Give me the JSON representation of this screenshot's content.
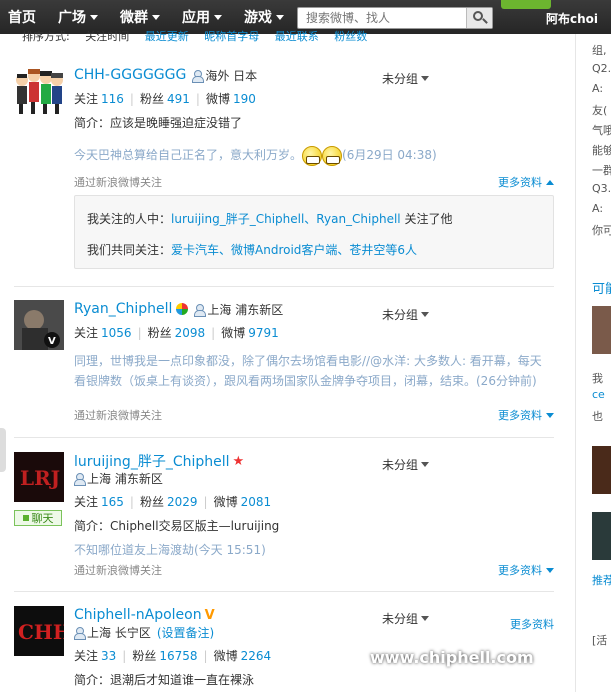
{
  "nav": {
    "items": [
      "首页",
      "广场",
      "微群",
      "应用",
      "游戏"
    ],
    "search_placeholder": "搜索微博、找人",
    "username": "阿布choi"
  },
  "sort": {
    "label": "排序方式:",
    "options": [
      "关注时间",
      "最近更新",
      "昵称首字母",
      "最近联系",
      "粉丝数"
    ]
  },
  "users": [
    {
      "name": "CHH-GGGGGGG",
      "location": "海外 日本",
      "following_label": "关注",
      "following": "116",
      "fans_label": "粉丝",
      "fans": "491",
      "weibo_label": "微博",
      "weibo": "190",
      "bio": "简介：应该是晚睡强迫症没错了",
      "latest": "今天巴神总算给自己正名了，意大利万岁。",
      "latest_time": "(6月29日 04:38)",
      "via": "通过新浪微博关注",
      "group": "未分组",
      "more": "更多资料"
    },
    {
      "name": "Ryan_Chiphell",
      "location": "上海 浦东新区",
      "following_label": "关注",
      "following": "1056",
      "fans_label": "粉丝",
      "fans": "2098",
      "weibo_label": "微博",
      "weibo": "9791",
      "latest": "同理，世博我是一点印象都没，除了偶尔去场馆看电影//@水洋: 大多数人: 看开幕，每天看银牌数（饭桌上有谈资），跟风看两场国家队金牌争夺项目，闭幕，结束。(26分钟前)",
      "via": "通过新浪微博关注",
      "group": "未分组",
      "more": "更多资料"
    },
    {
      "name": "luruijing_胖子_Chiphell",
      "location": "上海 浦东新区",
      "following_label": "关注",
      "following": "165",
      "fans_label": "粉丝",
      "fans": "2029",
      "weibo_label": "微博",
      "weibo": "2081",
      "chat": "聊天",
      "bio": "简介：Chiphell交易区版主—luruijing",
      "latest": "不知哪位道友上海渡劫(今天 15:51)",
      "via": "通过新浪微博关注",
      "group": "未分组",
      "more": "更多资料"
    },
    {
      "name": "Chiphell-nApoleon",
      "location": "上海 长宁区",
      "set_note": "(设置备注)",
      "following_label": "关注",
      "following": "33",
      "fans_label": "粉丝",
      "fans": "16758",
      "weibo_label": "微博",
      "weibo": "2264",
      "bio": "简介：退潮后才知道谁一直在裸泳",
      "group": "未分组",
      "more": "更多资料"
    }
  ],
  "relation_box": {
    "line1_prefix": "我关注的人中：",
    "line1_users": "luruijing_胖子_Chiphell、Ryan_Chiphell",
    "line1_suffix": "关注了他",
    "line2_prefix": "我们共同关注：",
    "line2_users": "爱卡汽车、微博Android客户端、苍井空",
    "line2_suffix": "等6人"
  },
  "sidebar": {
    "texts": [
      "组,",
      "Q2.",
      "A:",
      "友(",
      "气哦",
      "能够",
      "一群",
      "Q3.",
      "A:",
      "你可"
    ],
    "heading": "可能",
    "recommend": "推荐",
    "mid_texts": [
      "我",
      "ce",
      "也"
    ],
    "bottom_text": "[活"
  },
  "watermark": {
    "logo": "chip hell",
    "url": "www.chiphell.com"
  },
  "colors": {
    "link": "#0a8cd2",
    "nav_bg": "#2c2c2c",
    "latest_text": "#8ba9c9",
    "chat_green": "#5bb02f"
  }
}
